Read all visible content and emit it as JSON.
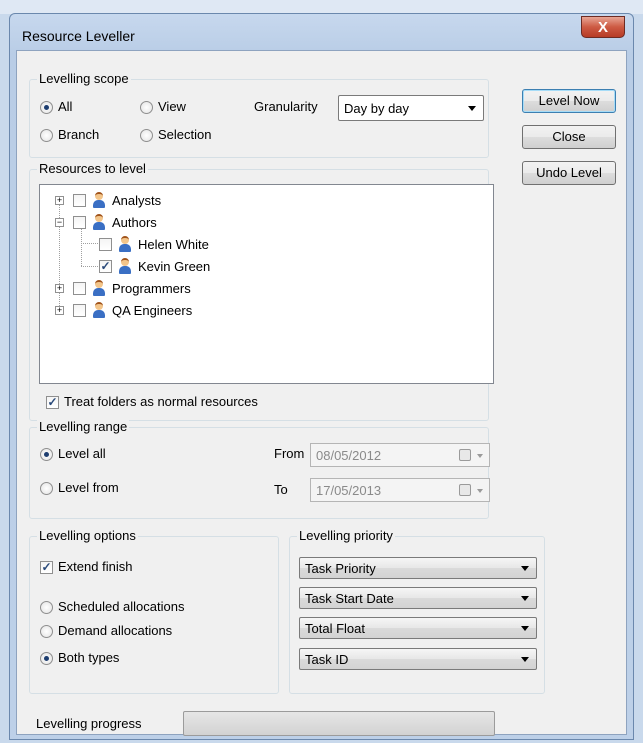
{
  "window": {
    "title": "Resource Leveller",
    "close_glyph": "X"
  },
  "buttons": {
    "level_now": "Level Now",
    "close": "Close",
    "undo_level": "Undo Level"
  },
  "scope": {
    "legend": "Levelling scope",
    "options": [
      {
        "label": "All",
        "selected": true
      },
      {
        "label": "View",
        "selected": false
      },
      {
        "label": "Branch",
        "selected": false
      },
      {
        "label": "Selection",
        "selected": false
      }
    ],
    "granularity_label": "Granularity",
    "granularity_value": "Day by day"
  },
  "resources": {
    "legend": "Resources to level",
    "items": [
      {
        "label": "Analysts",
        "checked": false,
        "expander": "+"
      },
      {
        "label": "Authors",
        "checked": false,
        "expander": "−"
      },
      {
        "label": "Helen White",
        "checked": false
      },
      {
        "label": "Kevin Green",
        "checked": true
      },
      {
        "label": "Programmers",
        "checked": false,
        "expander": "+"
      },
      {
        "label": "QA Engineers",
        "checked": false,
        "expander": "+"
      }
    ],
    "treat_folders_label": "Treat folders as normal resources",
    "treat_folders_checked": true
  },
  "range": {
    "legend": "Levelling range",
    "level_all": "Level all",
    "level_from": "Level from",
    "level_all_selected": true,
    "from_label": "From",
    "from_value": "08/05/2012",
    "to_label": "To",
    "to_value": "17/05/2013"
  },
  "options": {
    "legend": "Levelling options",
    "extend_finish": "Extend finish",
    "extend_finish_checked": true,
    "allocations": [
      {
        "label": "Scheduled allocations",
        "selected": false
      },
      {
        "label": "Demand allocations",
        "selected": false
      },
      {
        "label": "Both types",
        "selected": true
      }
    ]
  },
  "priority": {
    "legend": "Levelling priority",
    "values": [
      "Task Priority",
      "Task Start Date",
      "Total Float",
      "Task ID"
    ]
  },
  "progress": {
    "label": "Levelling progress",
    "value": 0
  },
  "colors": {
    "accent": "#1d3d6f",
    "close_button": "#cd5a43",
    "window_frame": "#b9cde6"
  },
  "icons": {
    "person": "person-icon",
    "calendar": "calendar-icon",
    "close": "close-icon",
    "dropdown": "chevron-down-icon"
  }
}
